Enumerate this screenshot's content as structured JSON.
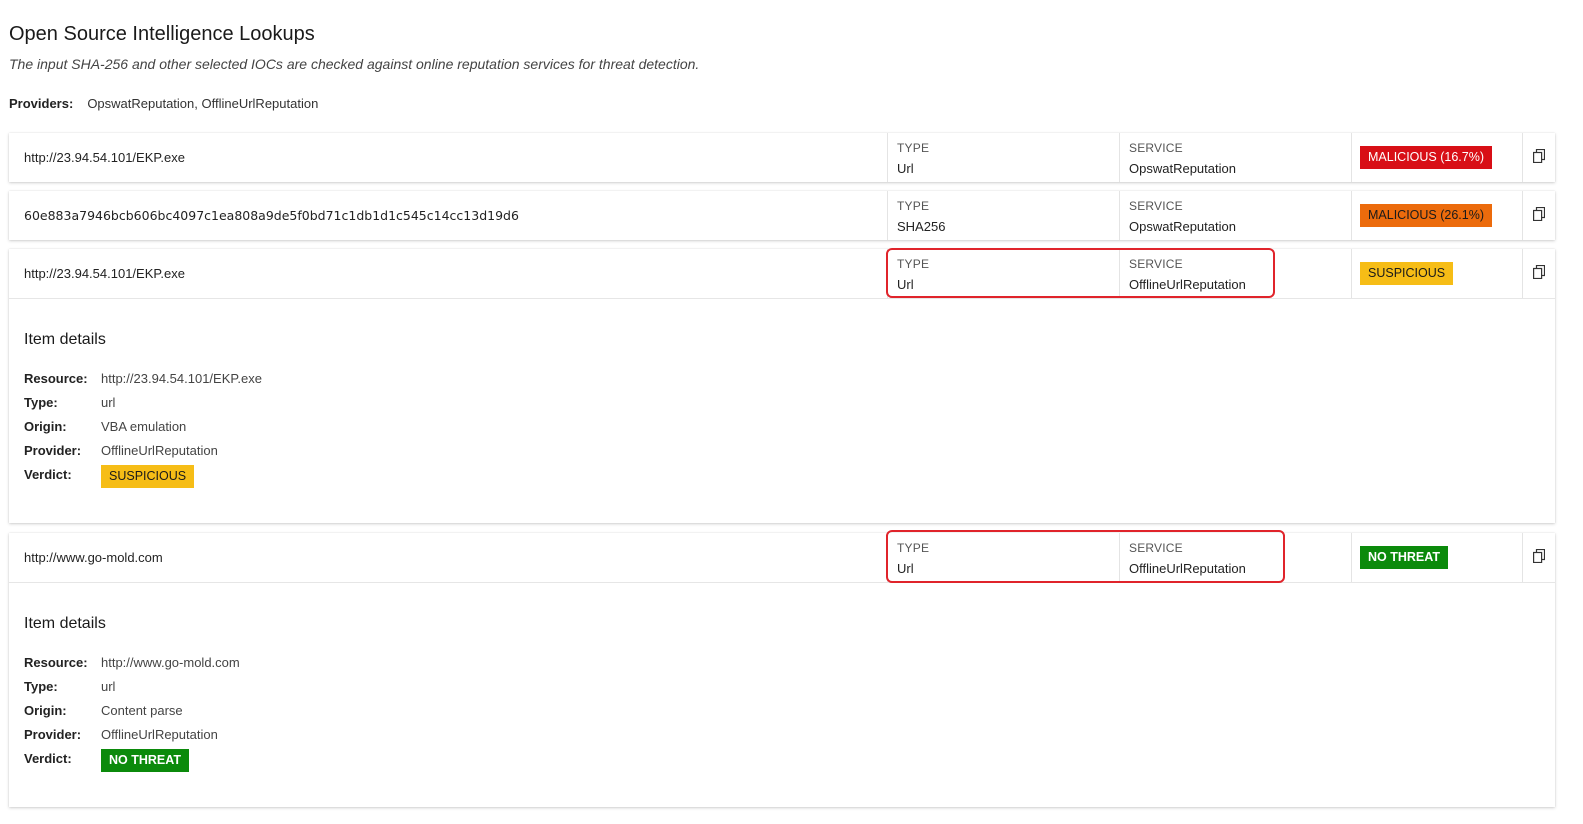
{
  "header": {
    "title": "Open Source Intelligence Lookups",
    "subtitle": "The input SHA-256 and other selected IOCs are checked against online reputation services for threat detection.",
    "providers_label": "Providers:",
    "providers_value": "OpswatReputation, OfflineUrlReputation"
  },
  "labels": {
    "type": "TYPE",
    "service": "SERVICE",
    "item_details": "Item details",
    "resource": "Resource:",
    "type_detail": "Type:",
    "origin": "Origin:",
    "provider": "Provider:",
    "verdict": "Verdict:"
  },
  "rows": [
    {
      "resource": "http://23.94.54.101/EKP.exe",
      "type": "Url",
      "service": "OpswatReputation",
      "verdict": "MALICIOUS (16.7%)"
    },
    {
      "resource": "60e883a7946bcb606bc4097c1ea808a9de5f0bd71c1db1d1c545c14cc13d19d6",
      "type": "SHA256",
      "service": "OpswatReputation",
      "verdict": "MALICIOUS (26.1%)"
    },
    {
      "resource": "http://23.94.54.101/EKP.exe",
      "type": "Url",
      "service": "OfflineUrlReputation",
      "verdict": "SUSPICIOUS",
      "details": {
        "resource": "http://23.94.54.101/EKP.exe",
        "type": "url",
        "origin": "VBA emulation",
        "provider": "OfflineUrlReputation",
        "verdict": "SUSPICIOUS"
      }
    },
    {
      "resource": "http://www.go-mold.com",
      "type": "Url",
      "service": "OfflineUrlReputation",
      "verdict": "NO THREAT",
      "details": {
        "resource": "http://www.go-mold.com",
        "type": "url",
        "origin": "Content parse",
        "provider": "OfflineUrlReputation",
        "verdict": "NO THREAT"
      }
    }
  ],
  "colors": {
    "malicious_high": "#d80f16",
    "malicious_medium": "#ec6b0c",
    "suspicious": "#f6bd16",
    "no_threat": "#0b8a0b",
    "highlight": "#e0242b"
  },
  "icons": {
    "copy": "copy-icon"
  }
}
